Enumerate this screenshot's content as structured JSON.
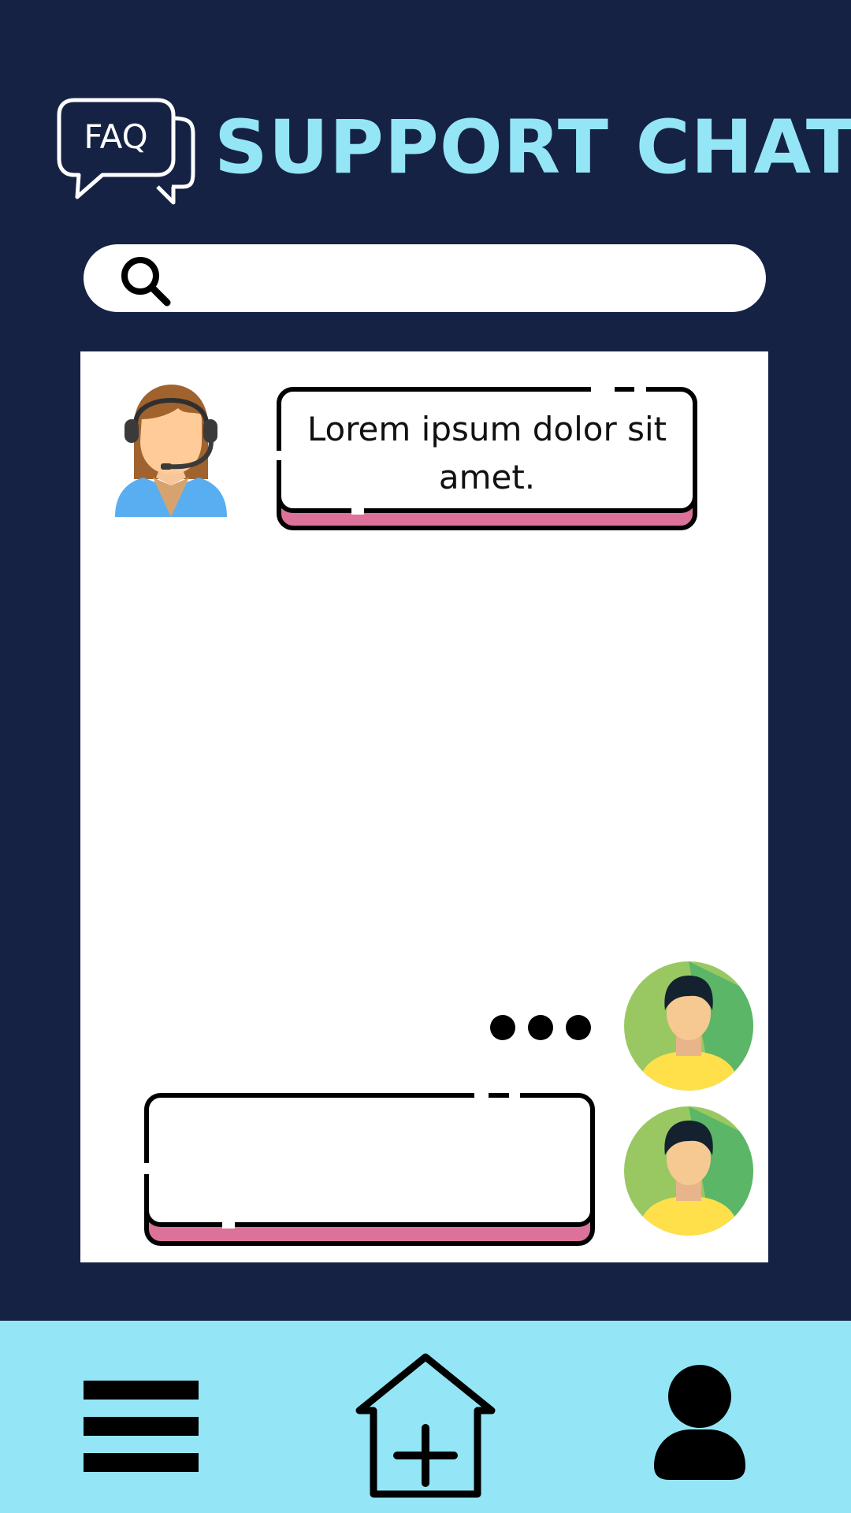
{
  "header": {
    "logo_text": "FAQ",
    "title": "SUPPORT CHAT"
  },
  "search": {
    "placeholder": "",
    "value": "",
    "icon": "search-icon"
  },
  "chat": {
    "messages": [
      {
        "sender": "agent",
        "avatar": "support-agent-avatar",
        "text": "Lorem ipsum dolor sit amet."
      },
      {
        "sender": "user",
        "avatar": "user-avatar",
        "typing": true
      }
    ],
    "reply_draft": ""
  },
  "bottom_nav": [
    {
      "name": "menu",
      "icon": "hamburger-menu-icon"
    },
    {
      "name": "home",
      "icon": "house-plus-icon"
    },
    {
      "name": "profile",
      "icon": "person-icon"
    }
  ],
  "colors": {
    "background": "#162244",
    "accent": "#94E6F6",
    "bubble_shadow": "#DC7299",
    "panel": "#FFFFFF"
  }
}
